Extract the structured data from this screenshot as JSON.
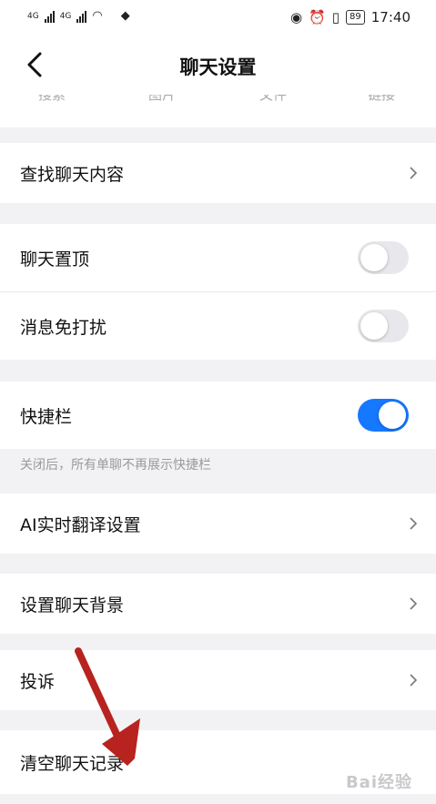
{
  "status_bar": {
    "net1": "4G",
    "net2": "4G",
    "battery": "89",
    "time": "17:40"
  },
  "header": {
    "title": "聊天设置"
  },
  "tabs_peek": [
    "搜索",
    "图片",
    "文件",
    "链接"
  ],
  "rows": {
    "search_chat": "查找聊天内容",
    "pin_chat": "聊天置顶",
    "do_not_disturb": "消息免打扰",
    "shortcut_bar": "快捷栏",
    "ai_translate": "AI实时翻译设置",
    "chat_background": "设置聊天背景",
    "complain": "投诉",
    "clear_history": "清空聊天记录"
  },
  "toggles": {
    "pin_chat": false,
    "do_not_disturb": false,
    "shortcut_bar": true
  },
  "shortcut_hint": "关闭后，所有单聊不再展示快捷栏",
  "watermark": "Bai经验",
  "colors": {
    "accent": "#1677ff",
    "arrow": "#b8221f",
    "page_bg": "#f2f2f4"
  }
}
